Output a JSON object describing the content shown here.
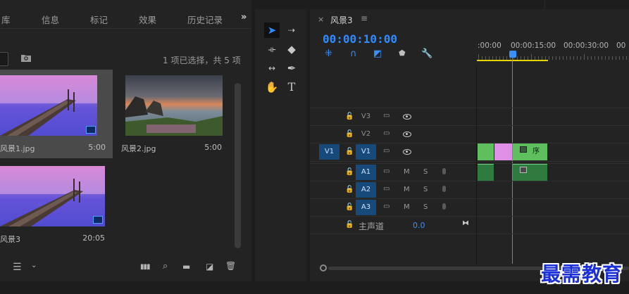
{
  "project_panel": {
    "tabs": [
      "库",
      "信息",
      "标记",
      "效果",
      "历史记录"
    ],
    "overflow_icon": "double-chevron-right-icon",
    "selection_info": "1 项已选择，共 5 项",
    "items": [
      {
        "name": "风景1.jpg",
        "duration": "5:00",
        "selected": true
      },
      {
        "name": "风景2.jpg",
        "duration": "5:00",
        "selected": false
      },
      {
        "name": "风景3",
        "duration": "20:05",
        "selected": false
      }
    ],
    "bottom_icons": [
      "list-view-icon",
      "sort-icon",
      "freeform-icon",
      "search-icon",
      "new-bin-icon",
      "new-item-icon",
      "trash-icon"
    ]
  },
  "tools": [
    "selection-tool",
    "track-select-tool",
    "ripple-edit-tool",
    "razor-tool",
    "slip-tool",
    "pen-tool",
    "hand-tool",
    "type-tool"
  ],
  "timeline": {
    "sequence_name": "风景3",
    "timecode": "00:00:10:00",
    "ruler_labels": [
      ":00:00",
      "00:00:15:00",
      "00:00:30:00",
      "00"
    ],
    "video_tracks": [
      {
        "name": "V3",
        "source": ""
      },
      {
        "name": "V2",
        "source": ""
      },
      {
        "name": "V1",
        "source": "V1"
      }
    ],
    "audio_tracks": [
      {
        "name": "A1",
        "mute": "M",
        "solo": "S"
      },
      {
        "name": "A2",
        "mute": "M",
        "solo": "S"
      },
      {
        "name": "A3",
        "mute": "M",
        "solo": "S"
      }
    ],
    "master_label": "主声道",
    "master_value": "0.0",
    "clip_label": "序",
    "colors": {
      "video_clip": "#5fbf5f",
      "nested_clip": "#e08fe6",
      "audio_clip": "#2f7a3e",
      "playhead": "#3a8fff",
      "workarea": "#e6d300"
    }
  },
  "watermark": "最需教育"
}
